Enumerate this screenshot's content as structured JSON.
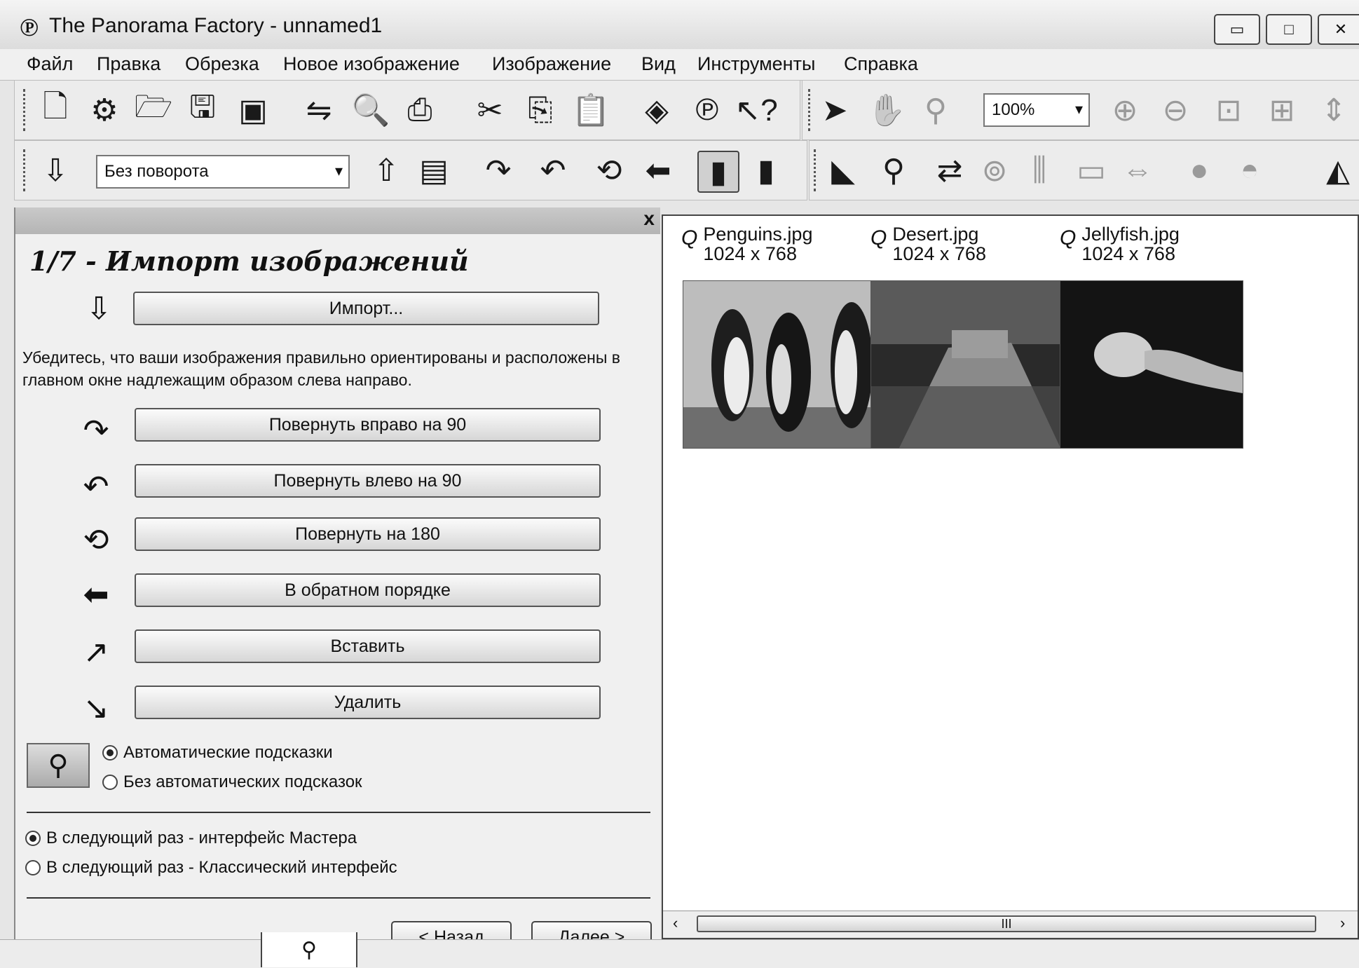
{
  "window": {
    "title": "The Panorama Factory - unnamed1",
    "app_icon": "panorama-factory-icon",
    "controls": {
      "minimize": "▭",
      "maximize": "□",
      "close": "✕"
    }
  },
  "menu": [
    "Файл",
    "Правка",
    "Обрезка",
    "Новое изображение",
    "Изображение",
    "Вид",
    "Инструменты",
    "Справка"
  ],
  "toolbar1": {
    "zoom_value": "100%",
    "icons": [
      "new-document-icon",
      "wizard-icon",
      "open-folder-icon",
      "save-icon",
      "package-icon",
      "stitch-icon",
      "preview-icon",
      "print-icon",
      "cut-icon",
      "copy-icon",
      "paste-icon",
      "eraser-icon",
      "panorama-icon",
      "help-context-icon",
      "pointer-icon",
      "hand-icon",
      "magnifier-icon",
      "zoom-in-icon",
      "zoom-out-icon",
      "fit-window-icon",
      "crosshair-icon",
      "vertical-fit-icon"
    ]
  },
  "toolbar2": {
    "rotation_value": "Без поворота",
    "icons": [
      "import-icon",
      "export-icon",
      "filmstrip-icon",
      "rotate-right-icon",
      "rotate-left-icon",
      "rotate-180-icon",
      "reverse-order-icon",
      "insert-frame-icon",
      "delete-frame-icon",
      "lens-icon",
      "search-icon",
      "align-icon",
      "blend-icon",
      "split-icon",
      "frame-icon",
      "spacing-icon",
      "sphere-icon",
      "globe-icon",
      "histogram-icon"
    ]
  },
  "wizard": {
    "close_label": "x",
    "step_title": "1/7 - Импорт изображений",
    "import_button": "Импорт...",
    "description": "Убедитесь, что ваши изображения правильно ориентированы и расположены в главном окне надлежащим образом слева направо.",
    "buttons": {
      "rotate_right": "Повернуть вправо на 90",
      "rotate_left": "Повернуть влево на 90",
      "rotate_180": "Повернуть на 180",
      "reverse": "В обратном порядке",
      "insert": "Вставить",
      "delete": "Удалить"
    },
    "hints": {
      "auto": "Автоматические подсказки",
      "none": "Без автоматических подсказок"
    },
    "interface": {
      "master": "В следующий раз - интерфейс Мастера",
      "classic": "В следующий раз - Классический интерфейс"
    },
    "nav": {
      "back": "< Назад",
      "next": "Далее >"
    }
  },
  "images": [
    {
      "name": "Penguins.jpg",
      "size": "1024 x 768",
      "marker": "Q"
    },
    {
      "name": "Desert.jpg",
      "size": "1024 x 768",
      "marker": "Q"
    },
    {
      "name": "Jellyfish.jpg",
      "size": "1024 x 768",
      "marker": "Q"
    }
  ],
  "scrollbar": {
    "left": "‹",
    "grip": "III",
    "right": "›"
  },
  "status_icon": "magnifier-icon"
}
